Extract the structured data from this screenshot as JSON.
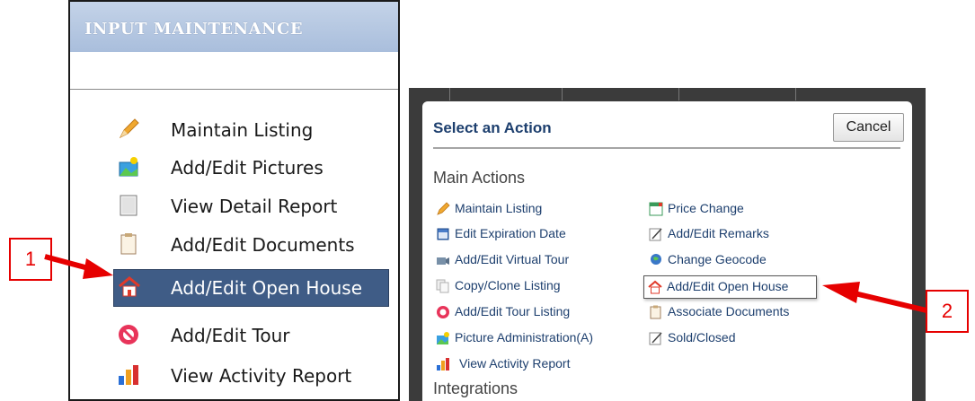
{
  "left_panel": {
    "title": "INPUT MAINTENANCE",
    "items": [
      {
        "label": "Maintain Listing",
        "icon": "pencil-icon"
      },
      {
        "label": "Add/Edit Pictures",
        "icon": "pictures-icon"
      },
      {
        "label": "View Detail Report",
        "icon": "report-icon"
      },
      {
        "label": "Add/Edit Documents",
        "icon": "documents-icon"
      },
      {
        "label": "Add/Edit Open House",
        "icon": "house-icon",
        "selected": true
      },
      {
        "label": "Add/Edit Tour",
        "icon": "tour-icon"
      },
      {
        "label": "View Activity Report",
        "icon": "activity-chart-icon"
      }
    ]
  },
  "dialog": {
    "title": "Select an Action",
    "cancel_label": "Cancel",
    "main_actions_heading": "Main Actions",
    "integrations_heading": "Integrations",
    "left_column": [
      {
        "label": "Maintain Listing",
        "icon": "pencil-icon"
      },
      {
        "label": "Edit Expiration Date",
        "icon": "calendar-printer-icon"
      },
      {
        "label": "Add/Edit Virtual Tour",
        "icon": "virtual-tour-icon"
      },
      {
        "label": "Copy/Clone Listing",
        "icon": "copy-icon"
      },
      {
        "label": "Add/Edit Tour Listing",
        "icon": "tour-icon"
      },
      {
        "label": "Picture Administration(A)",
        "icon": "pictures-icon"
      },
      {
        "label": "View Activity Report",
        "icon": "activity-chart-icon"
      }
    ],
    "right_column": [
      {
        "label": "Price Change",
        "icon": "price-change-icon"
      },
      {
        "label": "Add/Edit Remarks",
        "icon": "remarks-icon"
      },
      {
        "label": "Change Geocode",
        "icon": "globe-icon"
      },
      {
        "label": "Add/Edit Open House",
        "icon": "house-icon",
        "highlighted": true
      },
      {
        "label": "Associate Documents",
        "icon": "documents-icon"
      },
      {
        "label": "Sold/Closed",
        "icon": "sold-icon"
      }
    ]
  },
  "callouts": [
    {
      "label": "1"
    },
    {
      "label": "2"
    }
  ],
  "colors": {
    "header_gradient": "#a9bedc",
    "selected_row": "#3f5c86",
    "link_text": "#1d3f6e",
    "callout_red": "#e60000"
  }
}
